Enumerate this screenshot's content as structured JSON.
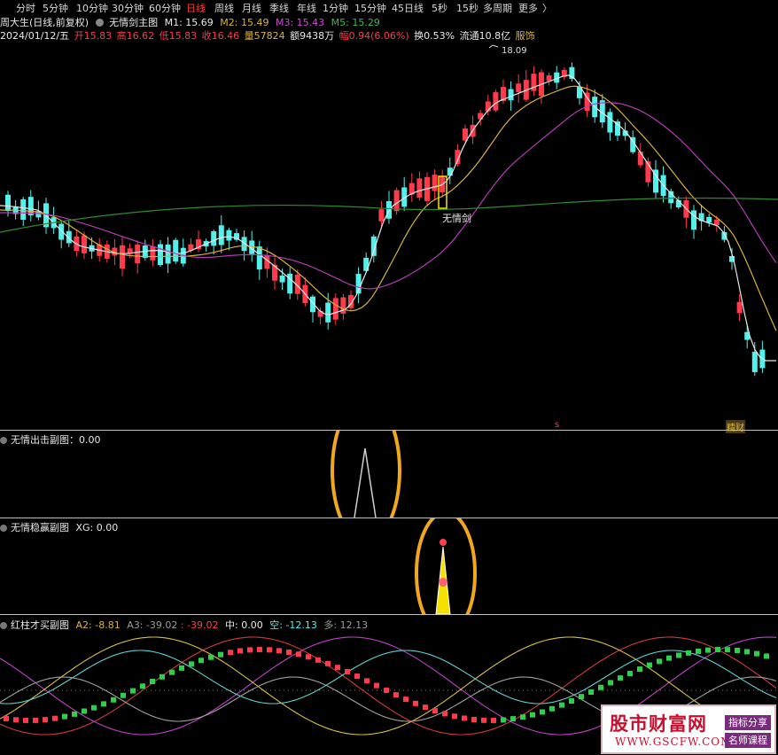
{
  "toolbar": {
    "periods": [
      "分时",
      "5分钟",
      "10分钟",
      "30分钟",
      "60分钟",
      "日线",
      "周线",
      "月线",
      "季线",
      "年线",
      "1分钟",
      "15分钟",
      "45日线",
      "5秒",
      "15秒",
      "多周期",
      "更多"
    ],
    "active": "日线",
    "more_arrow": "〉"
  },
  "info": {
    "stock": "周大生(日线,前复权)",
    "indicator": "无情剑主图",
    "m1": "M1: 15.69",
    "m2": "M2: 15.49",
    "m3": "M3: 15.43",
    "m5": "M5: 15.29",
    "date": "2024/01/12/五",
    "open": "开15.83",
    "high": "高16.62",
    "low": "低15.83",
    "close": "收16.46",
    "volume": "量57824",
    "amount": "额9438万",
    "change": "幅0.94(6.06%)",
    "turnover": "换0.53%",
    "float": "流通10.8亿",
    "sector": "服饰"
  },
  "main_chart": {
    "high_label": "18.09",
    "signal_label": "无情剑",
    "marker_s": "s",
    "marker_jc": "精财"
  },
  "panel1": {
    "title": "无情出击副图：0.00"
  },
  "panel2": {
    "title": "无情稳赢副图",
    "xg": "XG: 0.00"
  },
  "panel3": {
    "title": "红柱才买副图",
    "a2": "A2: -8.81",
    "a3": "A3: -39.02",
    "a3v": ": -39.02",
    "mid": "中: 0.00",
    "kong": "空: -12.13",
    "duo": "多: 12.13"
  },
  "watermark": {
    "title": "股市财富网",
    "url": "WWW.GSCFW.COM",
    "tag1": "指标分享",
    "tag2": "名师课程"
  },
  "colors": {
    "up": "#ff3a4a",
    "down": "#54f0ec",
    "ma_white": "#e8e8e8",
    "ma_yellow": "#d8b23a",
    "ma_purple": "#b43ab4",
    "ma_green": "#2e8b2e",
    "highlight_ring": "#f2a81d"
  }
}
